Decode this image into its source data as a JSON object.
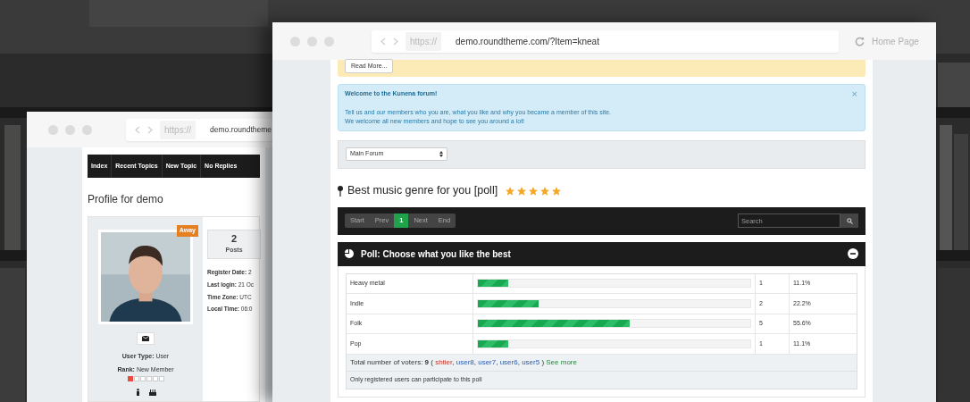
{
  "back_window": {
    "address": {
      "scheme": "https://",
      "url": "demo.roundtheme"
    },
    "nav": [
      {
        "label": "Index"
      },
      {
        "label": "Recent Topics"
      },
      {
        "label": "New Topic"
      },
      {
        "label": "No Replies"
      }
    ],
    "title": "Profile for demo",
    "profile": {
      "badge": "Away",
      "user_type": "**User Type:** User",
      "rank": "**Rank:** New Member",
      "stars": 1,
      "stat": {
        "value": "2",
        "label": "Posts"
      },
      "details": [
        "**Register Date:** 2",
        "**Last login:** 21 Oc",
        "**Time Zone:** UTC",
        "**Local Time:** 06:0"
      ]
    }
  },
  "front_window": {
    "address": {
      "scheme": "https://",
      "url": "demo.roundtheme.com/?Item=kneat"
    },
    "home": "Home Page",
    "notice": {
      "button": "Read More..."
    },
    "alert": {
      "title": "Welcome to the Kunena forum!",
      "lines": [
        "Tell us and our members who you are, what you like and why you became a member of this site.",
        "We welcome all new members and hope to see you around a lot!"
      ],
      "close": "×"
    },
    "forum_select": "Main Forum",
    "topic": {
      "title": "Best music genre for you [poll]",
      "stars": 5
    },
    "pagination": [
      {
        "label": "Start",
        "selected": false
      },
      {
        "label": "Prev",
        "selected": false
      },
      {
        "label": "1",
        "selected": true
      },
      {
        "label": "Next",
        "selected": false
      },
      {
        "label": "End",
        "selected": false
      }
    ],
    "search": {
      "placeholder": "Search"
    },
    "poll": {
      "title": "Poll: Choose what you like the best",
      "options": [
        {
          "name": "Heavy metal",
          "level": 0.111,
          "votes": "1",
          "percent": "11.1%"
        },
        {
          "name": "Indie",
          "level": 0.222,
          "votes": "2",
          "percent": "22.2%"
        },
        {
          "name": "Folk",
          "level": 0.556,
          "votes": "5",
          "percent": "55.6%"
        },
        {
          "name": "Pop",
          "level": 0.111,
          "votes": "1",
          "percent": "11.1%"
        }
      ],
      "voters": {
        "label": "Total number of voters:",
        "count": "9",
        "open": "(",
        "names": [
          {
            "name": "shtier",
            "kind": "moderator"
          },
          {
            "name": "user8",
            "kind": "user"
          },
          {
            "name": "user7",
            "kind": "user"
          },
          {
            "name": "user6",
            "kind": "user"
          },
          {
            "name": "user5",
            "kind": "user"
          }
        ],
        "separator": ",",
        "close": ")",
        "more": "See more"
      },
      "note": "Only registered users can participate to this poll"
    }
  }
}
